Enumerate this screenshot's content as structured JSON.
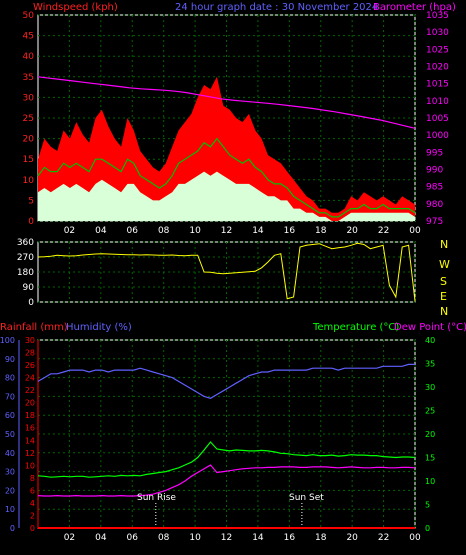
{
  "header": {
    "wind_label": "Windspeed (kph)",
    "title": "24 hour graph date : 30 November 2024",
    "baro_label": "Barometer (hpa)"
  },
  "mid_header": {
    "rain_label": "Rainfall (mm)",
    "humidity_label": "Humidity (%)",
    "temp_label": "Temperature (°C)",
    "dew_label": "Dew Point (°C)"
  },
  "annotations": {
    "sunrise": "Sun Rise",
    "sunset": "Sun Set"
  },
  "compass": [
    "N",
    "W",
    "S",
    "E",
    "N"
  ],
  "colors": {
    "wind_gust": "#ff0000",
    "wind_avg": "#00c000",
    "wind_speed": "#d8ffd8",
    "barometer": "#ff00ff",
    "direction": "#ffff00",
    "humidity": "#6060ff",
    "temperature": "#00ff00",
    "dewpoint": "#ff00ff",
    "rainfall": "#ff0000",
    "grid": "#006400",
    "axis": "#ffffff",
    "wind_axis": "#ff2020",
    "baro_axis": "#ff00ff",
    "temp_axis": "#00ff00"
  },
  "chart_data": [
    {
      "type": "area",
      "x_ticks": [
        "02",
        "04",
        "06",
        "08",
        "10",
        "12",
        "14",
        "16",
        "18",
        "20",
        "22",
        "00"
      ],
      "y_left_ticks": [
        "0",
        "5",
        "10",
        "15",
        "20",
        "25",
        "30",
        "35",
        "40",
        "45",
        "50"
      ],
      "y_right_ticks": [
        "975",
        "980",
        "985",
        "990",
        "995",
        "1000",
        "1005",
        "1010",
        "1015",
        "1020",
        "1025",
        "1030",
        "1035"
      ],
      "ylim": [
        0,
        50
      ],
      "y2lim": [
        975,
        1035
      ],
      "series": [
        {
          "name": "Windspeed (kph)",
          "unit": "kph",
          "gust": [
            15,
            20,
            18,
            17,
            22,
            20,
            24,
            21,
            19,
            25,
            27,
            23,
            20,
            18,
            25,
            22,
            17,
            15,
            13,
            12,
            14,
            18,
            22,
            24,
            26,
            30,
            33,
            32,
            35,
            28,
            27,
            25,
            24,
            26,
            22,
            20,
            16,
            15,
            14,
            12,
            10,
            8,
            6,
            5,
            3,
            3,
            2,
            2,
            3,
            6,
            5,
            7,
            6,
            5,
            6,
            5,
            4,
            6,
            5,
            4
          ],
          "avg": [
            11,
            13,
            12,
            12,
            14,
            13,
            14,
            13,
            12,
            15,
            15,
            14,
            13,
            12,
            15,
            14,
            11,
            10,
            9,
            8,
            9,
            11,
            14,
            15,
            16,
            17,
            19,
            18,
            20,
            18,
            16,
            15,
            14,
            15,
            13,
            12,
            10,
            9,
            9,
            8,
            6,
            5,
            4,
            3,
            2,
            2,
            1,
            1,
            2,
            3,
            3,
            4,
            3,
            3,
            4,
            3,
            3,
            3,
            3,
            2
          ],
          "speed": [
            7,
            8,
            7,
            8,
            9,
            8,
            9,
            8,
            7,
            9,
            10,
            9,
            8,
            7,
            9,
            9,
            7,
            6,
            5,
            5,
            6,
            7,
            9,
            9,
            10,
            11,
            12,
            11,
            12,
            11,
            10,
            9,
            9,
            9,
            8,
            7,
            6,
            6,
            5,
            5,
            3,
            3,
            2,
            2,
            1,
            1,
            0,
            0,
            1,
            2,
            2,
            2,
            2,
            2,
            2,
            2,
            2,
            2,
            2,
            1
          ]
        },
        {
          "name": "Barometer (hpa)",
          "unit": "hpa",
          "values": [
            1017,
            1016.6,
            1016.2,
            1015.8,
            1015.4,
            1015,
            1014.6,
            1014.2,
            1013.8,
            1013.5,
            1013.3,
            1013.1,
            1012.8,
            1012.4,
            1011.8,
            1011.2,
            1010.6,
            1010.2,
            1009.9,
            1009.6,
            1009.3,
            1009.0,
            1008.6,
            1008.2,
            1007.8,
            1007.3,
            1006.8,
            1006.2,
            1005.6,
            1005.0,
            1004.4,
            1003.6,
            1002.8,
            1002.0
          ]
        }
      ]
    },
    {
      "type": "line",
      "x_ticks": [
        "02",
        "04",
        "06",
        "08",
        "10",
        "12",
        "14",
        "16",
        "18",
        "20",
        "22",
        "00"
      ],
      "y_left_ticks": [
        "0",
        "90",
        "180",
        "270",
        "360"
      ],
      "ylim": [
        0,
        360
      ],
      "series": [
        {
          "name": "Wind Direction",
          "unit": "deg",
          "values": [
            270,
            272,
            275,
            280,
            278,
            276,
            278,
            282,
            285,
            288,
            290,
            288,
            286,
            285,
            284,
            283,
            282,
            283,
            282,
            281,
            280,
            282,
            279,
            278,
            280,
            281,
            180,
            178,
            172,
            170,
            172,
            175,
            178,
            182,
            185,
            205,
            240,
            280,
            290,
            20,
            30,
            330,
            340,
            345,
            350,
            335,
            320,
            325,
            330,
            340,
            352,
            345,
            320,
            330,
            340,
            100,
            30,
            330,
            340,
            5
          ]
        }
      ]
    },
    {
      "type": "line",
      "x_ticks": [
        "02",
        "04",
        "06",
        "08",
        "10",
        "12",
        "14",
        "16",
        "18",
        "20",
        "22",
        "00"
      ],
      "y_left_ticks": [
        "0",
        "10",
        "20",
        "30",
        "40",
        "50",
        "60",
        "70",
        "80",
        "90",
        "100"
      ],
      "y_rain_ticks": [
        "0",
        "2",
        "4",
        "6",
        "8",
        "10",
        "12",
        "14",
        "16",
        "18",
        "20",
        "22",
        "24",
        "26",
        "28",
        "30"
      ],
      "y_right_ticks": [
        "0",
        "5",
        "10",
        "15",
        "20",
        "25",
        "30",
        "35",
        "40"
      ],
      "ylim": [
        0,
        100
      ],
      "y2lim": [
        0,
        40
      ],
      "series": [
        {
          "name": "Humidity (%)",
          "unit": "%",
          "values": [
            78,
            80,
            82,
            82,
            83,
            84,
            84,
            84,
            83,
            84,
            84,
            83,
            84,
            84,
            84,
            84,
            85,
            84,
            83,
            82,
            81,
            80,
            78,
            76,
            74,
            72,
            70,
            69,
            71,
            73,
            75,
            77,
            79,
            81,
            82,
            83,
            83,
            84,
            84,
            84,
            84,
            84,
            84,
            85,
            85,
            85,
            85,
            84,
            85,
            85,
            85,
            85,
            85,
            85,
            86,
            86,
            86,
            86,
            87,
            87
          ]
        },
        {
          "name": "Temperature (°C)",
          "unit": "°C",
          "values": [
            11.1,
            11.0,
            10.8,
            10.9,
            11.0,
            10.9,
            11.0,
            11.0,
            10.8,
            10.9,
            11.0,
            11.1,
            11.0,
            11.2,
            11.1,
            11.2,
            11.1,
            11.4,
            11.6,
            11.8,
            12.0,
            12.4,
            12.8,
            13.4,
            14.0,
            15.0,
            16.6,
            18.3,
            16.8,
            16.6,
            16.4,
            16.6,
            16.5,
            16.4,
            16.4,
            16.5,
            16.4,
            16.2,
            15.9,
            15.8,
            15.6,
            15.5,
            15.4,
            15.6,
            15.4,
            15.4,
            15.5,
            15.3,
            15.4,
            15.6,
            15.5,
            15.5,
            15.4,
            15.4,
            15.2,
            15.1,
            15.0,
            15.1,
            15.1,
            15.0
          ]
        },
        {
          "name": "Dew Point (°C)",
          "unit": "°C",
          "values": [
            6.9,
            6.8,
            6.8,
            6.9,
            6.8,
            6.8,
            6.9,
            6.8,
            6.8,
            6.8,
            6.9,
            6.8,
            6.8,
            6.9,
            6.8,
            6.8,
            6.9,
            7.0,
            7.2,
            7.6,
            8.0,
            8.6,
            9.2,
            10.0,
            11.0,
            11.8,
            12.6,
            13.4,
            11.8,
            12.0,
            12.2,
            12.4,
            12.6,
            12.7,
            12.8,
            12.8,
            12.9,
            12.9,
            13.0,
            13.0,
            13.0,
            12.9,
            12.9,
            13.0,
            13.0,
            13.0,
            12.9,
            12.8,
            12.9,
            13.0,
            12.9,
            12.8,
            12.8,
            12.9,
            12.9,
            12.8,
            12.8,
            12.9,
            12.9,
            12.8
          ]
        },
        {
          "name": "Rainfall (mm)",
          "unit": "mm",
          "values": [
            0,
            0,
            0,
            0,
            0,
            0,
            0,
            0,
            0,
            0,
            0,
            0,
            0,
            0,
            0,
            0,
            0,
            0,
            0,
            0,
            0,
            0,
            0,
            0,
            0,
            0,
            0,
            0,
            0,
            0,
            0,
            0,
            0,
            0,
            0,
            0,
            0,
            0,
            0,
            0,
            0,
            0,
            0,
            0,
            0,
            0,
            0,
            0,
            0,
            0,
            0,
            0,
            0,
            0,
            0,
            0,
            0,
            0,
            0,
            0
          ]
        }
      ]
    }
  ]
}
